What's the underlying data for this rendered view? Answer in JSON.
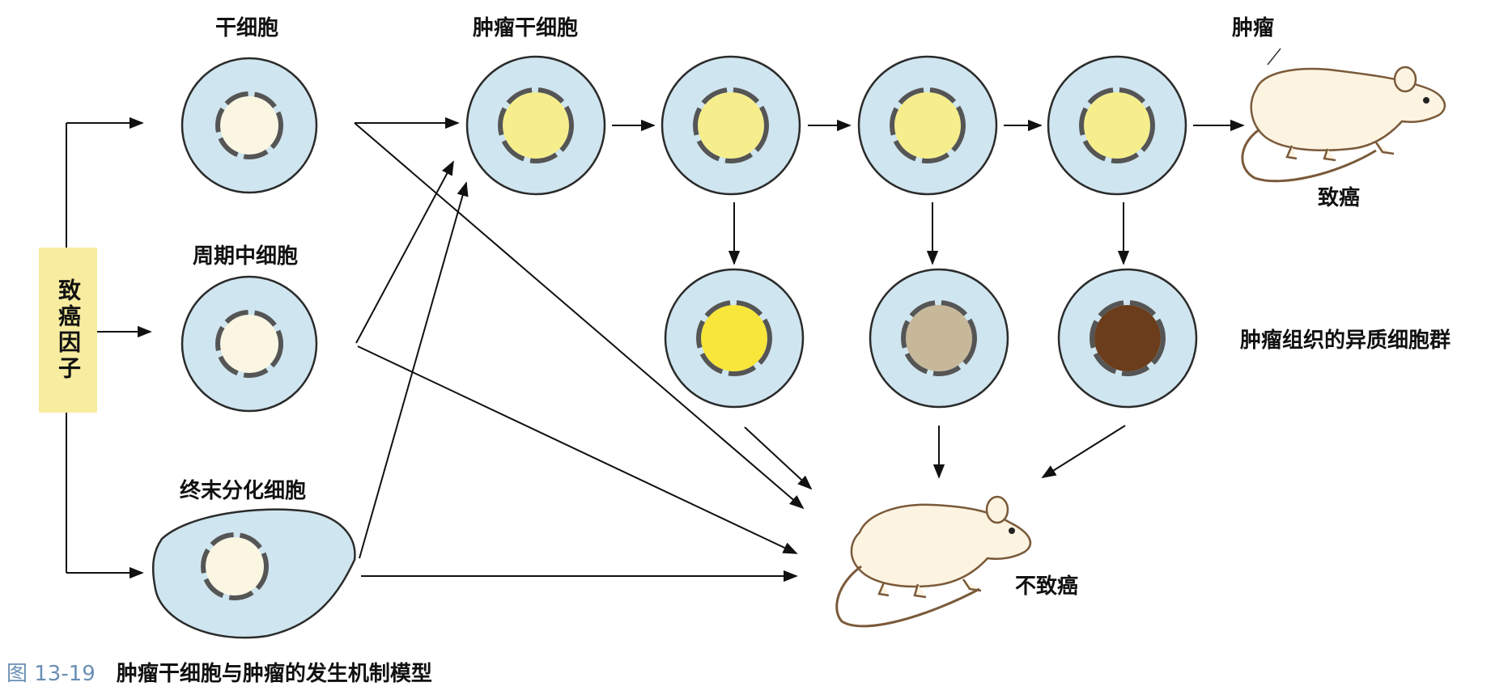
{
  "labels": {
    "stem_cell": "干细胞",
    "cycling_cell": "周期中细胞",
    "terminal_cell": "终末分化细胞",
    "tumor_stem_cell": "肿瘤干细胞",
    "tumor": "肿瘤",
    "tumorigenic": "致癌",
    "heterogeneous": "肿瘤组织的异质细胞群",
    "non_tumorigenic": "不致癌",
    "carcinogen": "致癌因子"
  },
  "caption": {
    "number": "图 13-19",
    "text": "肿瘤干细胞与肿瘤的发生机制模型"
  },
  "colors": {
    "cytoplasm": "#cfe5ef",
    "cell_outline": "#2b2b2b",
    "nucleus_normal": "#fbf6e2",
    "nucleus_tumor": "#f6ee8c",
    "nucleus_bright": "#f8e63a",
    "nucleus_tan": "#c8b89a",
    "nucleus_brown": "#6b3d1c",
    "factor_box": "#f7eca0",
    "mouse_body": "#fdf3e1",
    "caption_number": "#6a8fb5"
  }
}
